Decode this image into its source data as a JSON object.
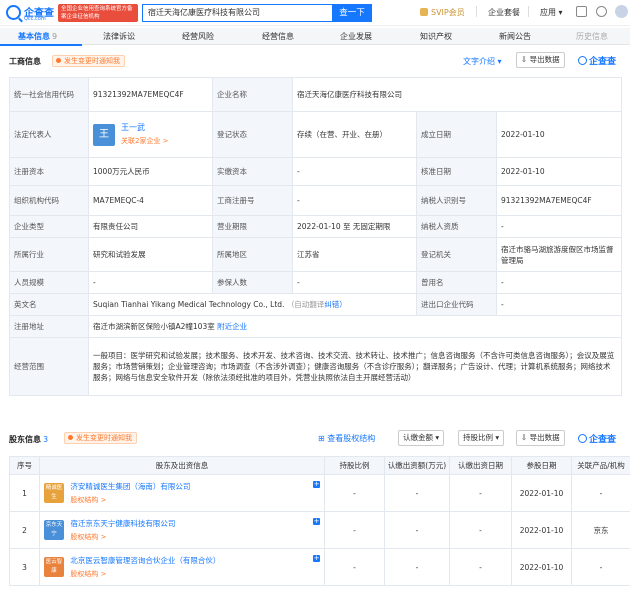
{
  "header": {
    "logo_text": "企查查",
    "logo_sub": "Qcc.com",
    "logo_tag": "全国企业信用查询系统官方备案企业征信机构",
    "search_value": "宿迁天海亿康医疗科技有限公司",
    "search_button": "查一下",
    "svip": "SVIP会员",
    "enterprise": "企业套餐",
    "apps": "应用"
  },
  "tabs": [
    {
      "label": "基本信息",
      "count": "9"
    },
    {
      "label": "法律诉讼"
    },
    {
      "label": "经营风险"
    },
    {
      "label": "经营信息"
    },
    {
      "label": "企业发展"
    },
    {
      "label": "知识产权"
    },
    {
      "label": "新闻公告"
    },
    {
      "label": "历史信息"
    }
  ],
  "business": {
    "title": "工商信息",
    "change_tag": "发生变更时通知我",
    "intro_link": "文字介绍",
    "export": "导出数据",
    "watermark": "企查查",
    "labels": {
      "credit_code": "统一社会信用代码",
      "company_name": "企业名称",
      "legal_rep": "法定代表人",
      "status": "登记状态",
      "established": "成立日期",
      "reg_capital": "注册资本",
      "paid_capital": "实缴资本",
      "approval_date": "核准日期",
      "org_code": "组织机构代码",
      "reg_no": "工商注册号",
      "taxpayer_id": "纳税人识别号",
      "company_type": "企业类型",
      "term": "营业期限",
      "taxpayer_qual": "纳税人资质",
      "industry": "所属行业",
      "region": "所属地区",
      "authority": "登记机关",
      "staff": "人员规模",
      "insured": "参保人数",
      "former_name": "曾用名",
      "english_name": "英文名",
      "import_export": "进出口企业代码",
      "address": "注册地址",
      "scope": "经营范围"
    },
    "values": {
      "credit_code": "91321392MA7EMEQC4F",
      "company_name": "宿迁天海亿康医疗科技有限公司",
      "legal_rep_avatar": "王",
      "legal_rep_name": "王一武",
      "legal_rep_link": "关联2家企业 >",
      "status": "存续（在营、开业、在册）",
      "established": "2022-01-10",
      "reg_capital": "1000万元人民币",
      "paid_capital": "-",
      "approval_date": "2022-01-10",
      "org_code": "MA7EMEQC-4",
      "reg_no": "-",
      "taxpayer_id": "91321392MA7EMEQC4F",
      "company_type": "有限责任公司",
      "term": "2022-01-10 至 无固定期限",
      "taxpayer_qual": "-",
      "industry": "研究和试验发展",
      "region": "江苏省",
      "authority": "宿迁市骆马湖旅游度假区市场监督管理局",
      "staff": "-",
      "insured": "-",
      "former_name": "-",
      "english_name": "Suqian Tianhai Yikang Medical Technology Co., Ltd.",
      "english_note": "（自动翻译",
      "english_fix": "纠错）",
      "import_export": "-",
      "address": "宿迁市湖滨新区保险小镇A2幢103室",
      "address_link": "附近企业",
      "scope": "一般项目：医学研究和试验发展；技术服务、技术开发、技术咨询、技术交流、技术转让、技术推广；信息咨询服务（不含许可类信息咨询服务）；会议及展览服务；市场营销策划；企业管理咨询；市场调查（不含涉外调查）；健康咨询服务（不含诊疗服务）；翻译服务；广告设计、代理；计算机系统服务；网络技术服务；网络与信息安全软件开发（除依法须经批准的项目外，凭营业执照依法自主开展经营活动）"
    }
  },
  "shareholders": {
    "title": "股东信息",
    "count": "3",
    "change_tag": "发生变更时通知我",
    "structure_link": "查看股权结构",
    "sort1": "认缴金额",
    "sort2": "持股比例",
    "export": "导出数据",
    "watermark": "企查查",
    "columns": [
      "序号",
      "股东及出资信息",
      "持股比例",
      "认缴出资额(万元)",
      "认缴出资日期",
      "参股日期",
      "关联产品/机构"
    ],
    "rows": [
      {
        "no": "1",
        "badge": "精诚医生",
        "badge_color": "#e8a23c",
        "name": "济安精诚医生集团（海南）有限公司",
        "sub": "股权结构 >",
        "ratio": "-",
        "amount": "-",
        "date": "-",
        "joined": "2022-01-10",
        "product": "-"
      },
      {
        "no": "2",
        "badge": "京东天宁",
        "badge_color": "#4a90d9",
        "name": "宿迁京东天宁健康科技有限公司",
        "sub": "股权结构 >",
        "ratio": "-",
        "amount": "-",
        "date": "-",
        "joined": "2022-01-10",
        "product": "京东"
      },
      {
        "no": "3",
        "badge": "医云智康",
        "badge_color": "#e9823c",
        "name": "北京医云智康管理咨询合伙企业（有限合伙）",
        "sub": "股权结构 >",
        "ratio": "-",
        "amount": "-",
        "date": "-",
        "joined": "2022-01-10",
        "product": "-"
      }
    ]
  }
}
